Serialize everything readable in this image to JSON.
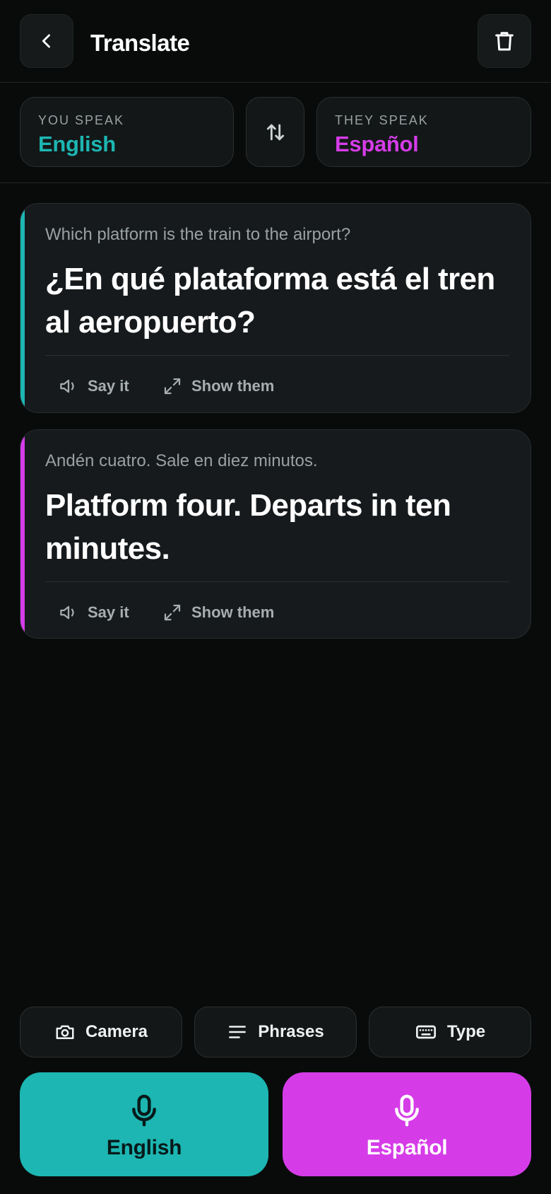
{
  "header": {
    "title": "Translate",
    "back_icon": "chevron-left-icon",
    "delete_icon": "trash-icon"
  },
  "languages": {
    "you_speak_caption": "YOU SPEAK",
    "you_speak_value": "English",
    "they_speak_caption": "THEY SPEAK",
    "they_speak_value": "Español",
    "swap_icon": "swap-vertical-icon"
  },
  "conversation": [
    {
      "source": "Which platform is the train to the airport?",
      "translation": "¿En qué plataforma está el tren al aeropuerto?",
      "accent": "#1db6b2",
      "say_label": "Say it",
      "show_label": "Show them"
    },
    {
      "source": "Andén cuatro. Sale en diez minutos.",
      "translation": "Platform four. Departs in ten minutes.",
      "accent": "#d53ce8",
      "say_label": "Say it",
      "show_label": "Show them"
    }
  ],
  "tools": {
    "camera_label": "Camera",
    "phrases_label": "Phrases",
    "type_label": "Type"
  },
  "mics": {
    "english_label": "English",
    "espanol_label": "Español"
  },
  "colors": {
    "background": "#090b0b",
    "teal": "#1db6b2",
    "magenta": "#d53ce8"
  }
}
